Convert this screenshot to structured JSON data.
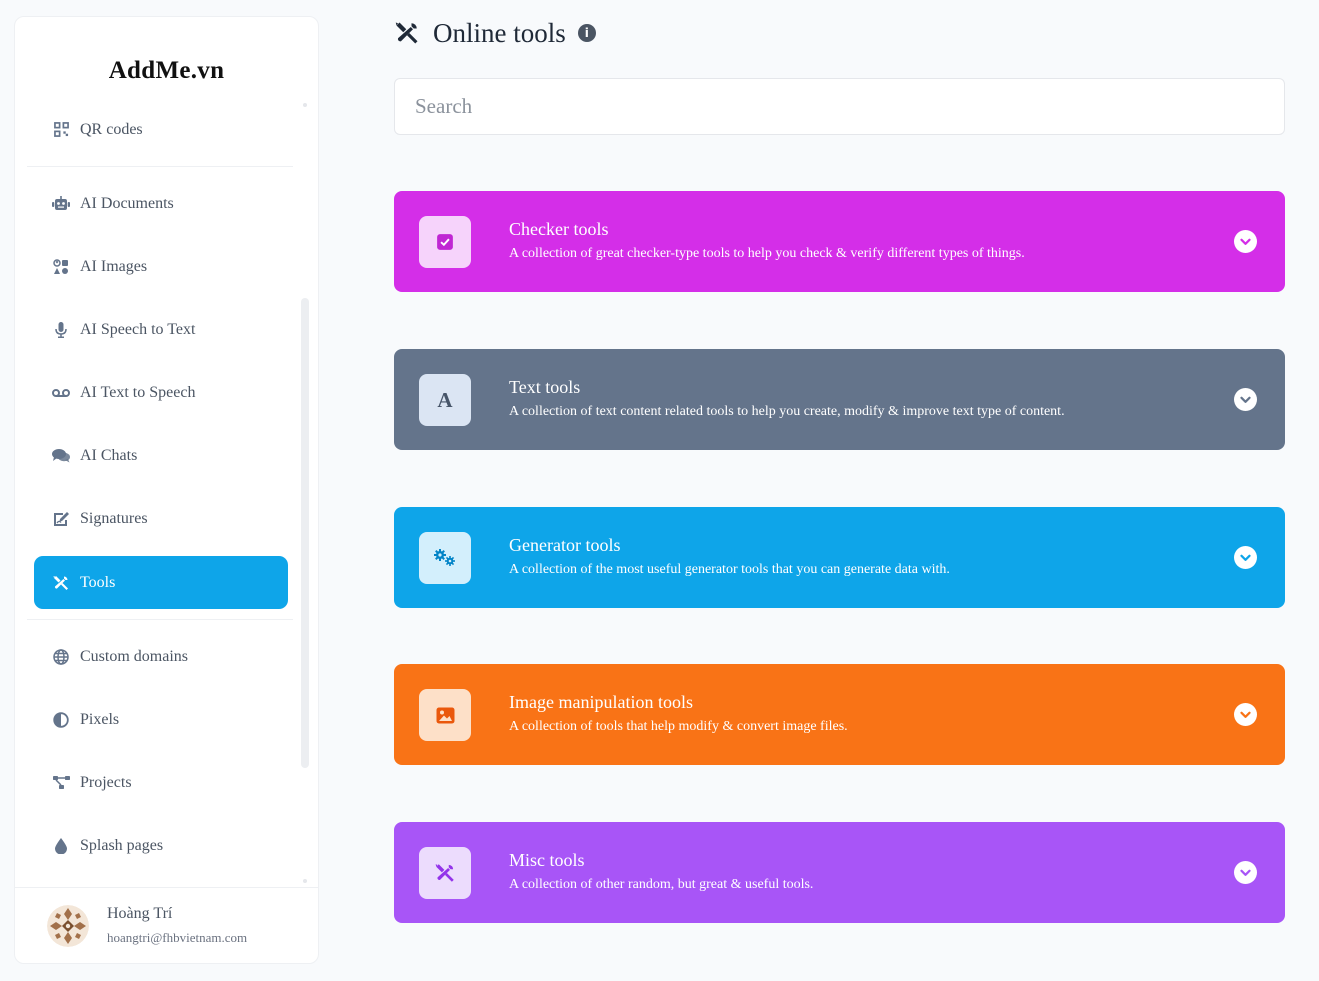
{
  "brand": "AddMe.vn",
  "sidebar": {
    "items": [
      {
        "label": "QR codes",
        "icon": "qr-code-icon"
      },
      {
        "label": "AI Documents",
        "icon": "robot-icon"
      },
      {
        "label": "AI Images",
        "icon": "icons-icon"
      },
      {
        "label": "AI Speech to Text",
        "icon": "microphone-icon"
      },
      {
        "label": "AI Text to Speech",
        "icon": "voicemail-icon"
      },
      {
        "label": "AI Chats",
        "icon": "comments-icon"
      },
      {
        "label": "Signatures",
        "icon": "signature-icon"
      },
      {
        "label": "Tools",
        "icon": "tools-icon",
        "active": true
      },
      {
        "label": "Custom domains",
        "icon": "globe-icon"
      },
      {
        "label": "Pixels",
        "icon": "adjust-icon"
      },
      {
        "label": "Projects",
        "icon": "project-diagram-icon"
      },
      {
        "label": "Splash pages",
        "icon": "droplet-icon"
      }
    ]
  },
  "user": {
    "name": "Hoàng Trí",
    "email": "hoangtri@fhbvietnam.com"
  },
  "main": {
    "title": "Online tools",
    "search_placeholder": "Search",
    "categories": [
      {
        "title": "Checker tools",
        "description": "A collection of great checker-type tools to help you check & verify different types of things.",
        "color": "#d42ee8",
        "tile_bg": "#f6d3fb",
        "icon_color": "#c026d3",
        "icon": "check-square-icon"
      },
      {
        "title": "Text tools",
        "description": "A collection of text content related tools to help you create, modify & improve text type of content.",
        "color": "#64748b",
        "tile_bg": "#dbe5f3",
        "icon_color": "#475569",
        "icon": "font-icon"
      },
      {
        "title": "Generator tools",
        "description": "A collection of the most useful generator tools that you can generate data with.",
        "color": "#0ea5e9",
        "tile_bg": "#d3effc",
        "icon_color": "#0284c7",
        "icon": "cogs-icon"
      },
      {
        "title": "Image manipulation tools",
        "description": "A collection of tools that help modify & convert image files.",
        "color": "#f97316",
        "tile_bg": "#fde0c8",
        "icon_color": "#ea580c",
        "icon": "image-icon"
      },
      {
        "title": "Misc tools",
        "description": "A collection of other random, but great & useful tools.",
        "color": "#a855f7",
        "tile_bg": "#ecdcfd",
        "icon_color": "#9333ea",
        "icon": "tools-icon"
      }
    ]
  }
}
